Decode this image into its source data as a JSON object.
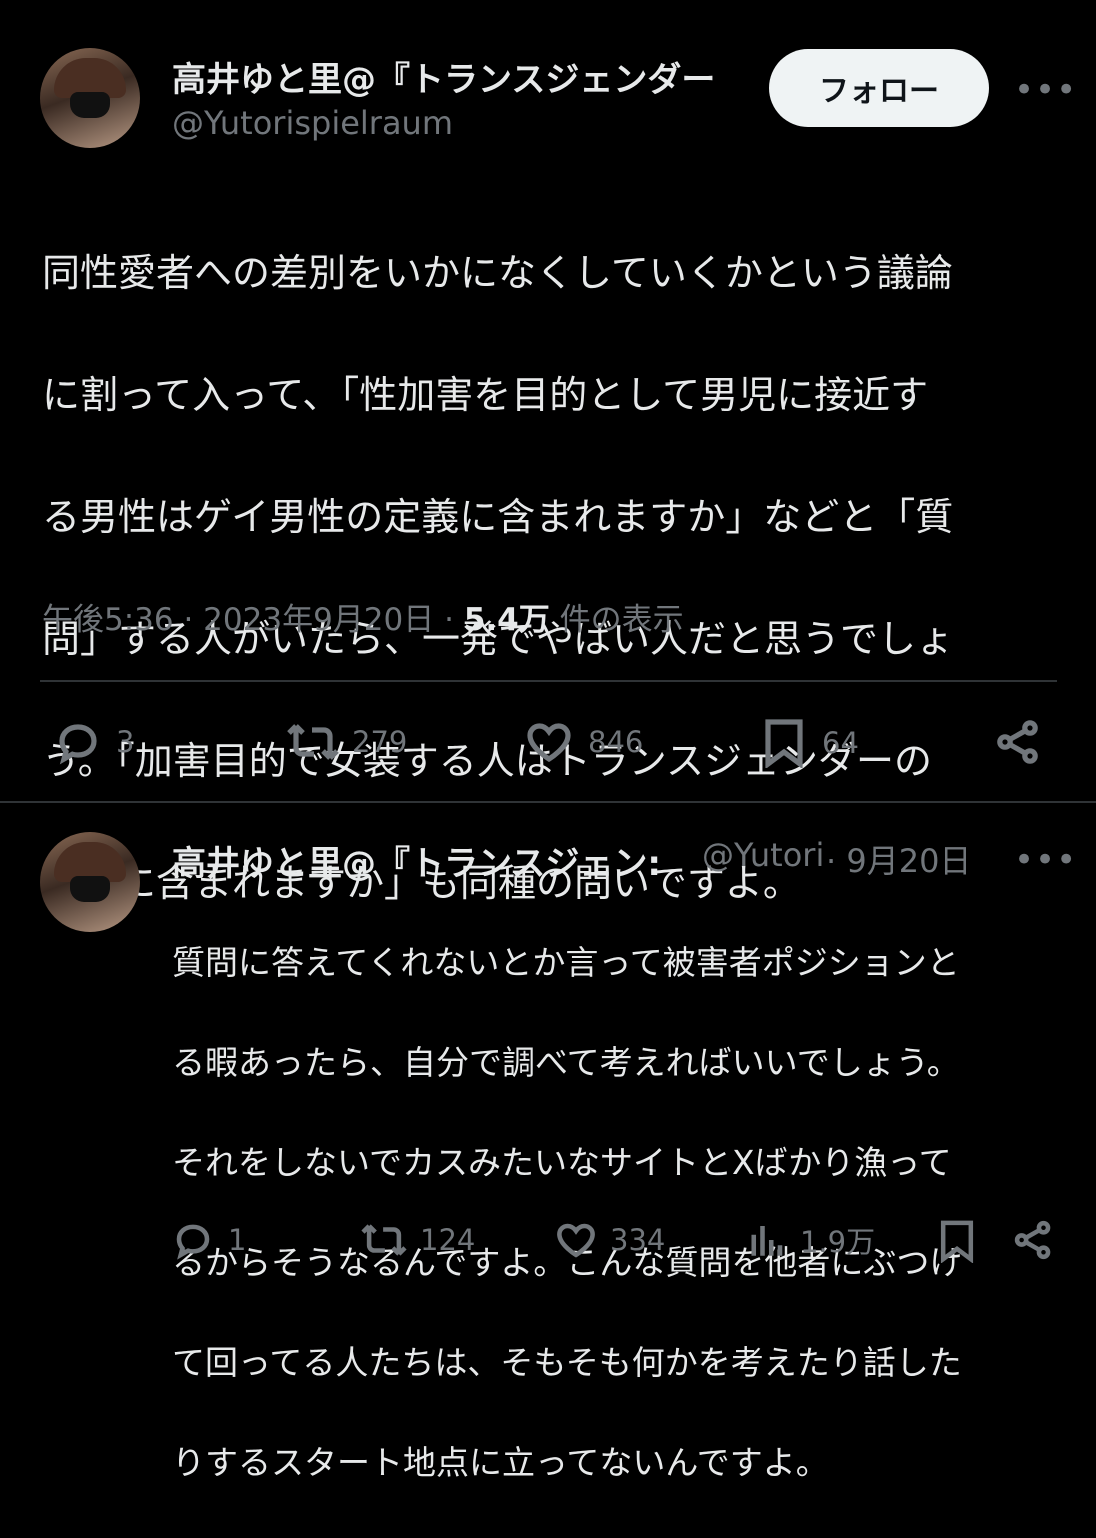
{
  "tweet": {
    "author_name": "高井ゆと里@『トランスジェンダー",
    "author_handle": "@Yutorispielraum",
    "follow_label": "フォロー",
    "more_glyph": "•••",
    "lines": [
      "同性愛者への差別をいかになくしていくかという議論",
      "に割って入って、「性加害を目的として男児に接近す",
      "る男性はゲイ男性の定義に含まれますか」などと「質",
      "問」する人がいたら、一発でやばい人だと思うでしょ",
      "う。「加害目的で女装する人はトランスジェンダーの",
      "定義に含まれますか」も同種の問いですよ。"
    ],
    "time": "午後5:36 · 2023年9月20日 · ",
    "views_count": "5.4万",
    "views_label": " 件の表示",
    "stats": {
      "replies": "3",
      "retweets": "279",
      "likes": "846",
      "bookmarks": "64"
    }
  },
  "reply": {
    "author_name": "高井ゆと里@『トランスジェン:",
    "author_handle": "@Yutori",
    "date": " · 9月20日",
    "more_glyph": "•••",
    "lines": [
      "質問に答えてくれないとか言って被害者ポジションと",
      "る暇あったら、自分で調べて考えればいいでしょう。",
      "それをしないでカスみたいなサイトとXばかり漁って",
      "るからそうなるんですよ。こんな質問を他者にぶつけ",
      "て回ってる人たちは、そもそも何かを考えたり話した",
      "りするスタート地点に立ってないんですよ。"
    ],
    "stats": {
      "replies": "1",
      "retweets": "124",
      "likes": "334",
      "views": "1.9万"
    }
  },
  "colors": {
    "background": "#000000",
    "text": "#e7e9ea",
    "muted": "#71767b",
    "divider": "#2f3336",
    "button": "#eff3f4"
  },
  "icons": [
    "reply-icon",
    "retweet-icon",
    "like-icon",
    "bookmark-icon",
    "share-icon",
    "views-icon",
    "more-icon"
  ]
}
